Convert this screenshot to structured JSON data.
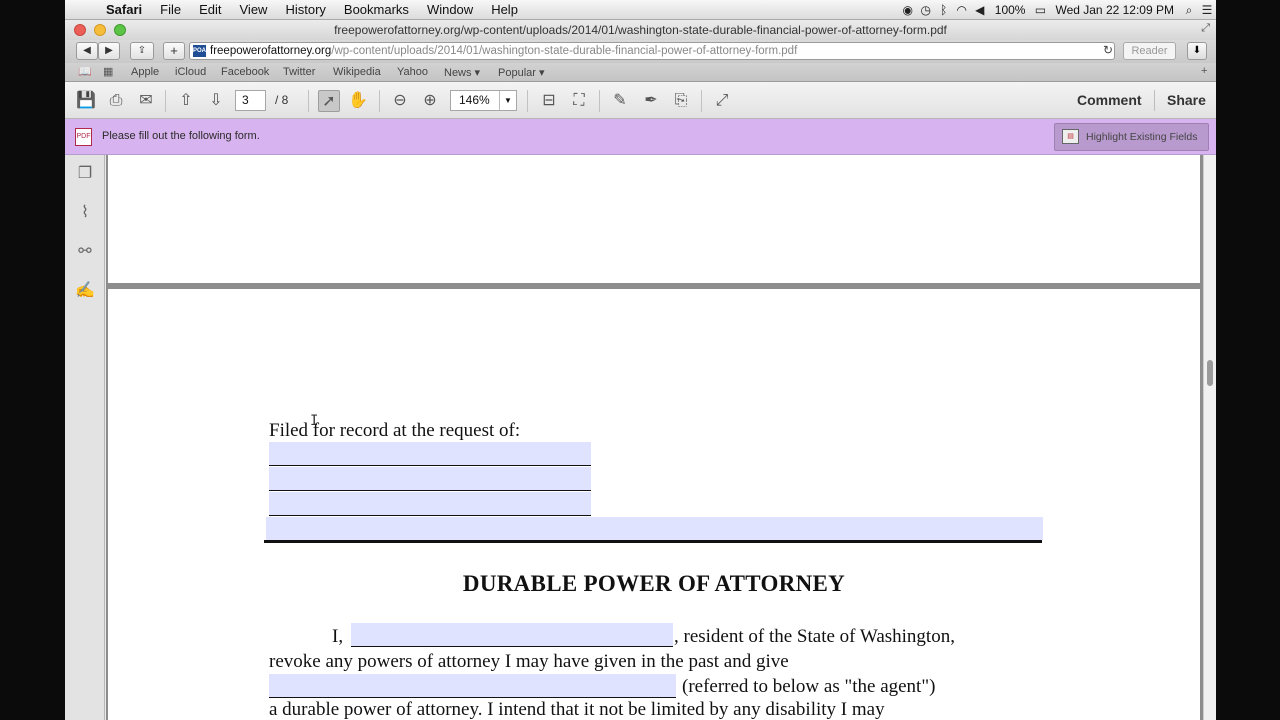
{
  "menubar": {
    "app": "Safari",
    "items": [
      "File",
      "Edit",
      "View",
      "History",
      "Bookmarks",
      "Window",
      "Help"
    ],
    "battery": "100%",
    "clock": "Wed Jan 22  12:09 PM"
  },
  "window": {
    "title": "freepowerofattorney.org/wp-content/uploads/2014/01/washington-state-durable-financial-power-of-attorney-form.pdf"
  },
  "toolbar": {
    "url_host": "freepowerofattorney.org",
    "url_path": "/wp-content/uploads/2014/01/washington-state-durable-financial-power-of-attorney-form.pdf",
    "favicon_text": "POA",
    "reader": "Reader"
  },
  "bookmarks": [
    "Apple",
    "iCloud",
    "Facebook",
    "Twitter",
    "Wikipedia",
    "Yahoo",
    "News ▾",
    "Popular ▾"
  ],
  "acrobat": {
    "page_current": "3",
    "page_total": "/ 8",
    "zoom": "146%",
    "comment": "Comment",
    "share": "Share"
  },
  "formbar": {
    "message": "Please fill out the following form.",
    "highlight_button": "Highlight Existing Fields"
  },
  "document": {
    "filed_for_record": "Filed for record at the request of:",
    "heading": "DURABLE POWER OF ATTORNEY",
    "line1_prefix": "I,",
    "line1_suffix": ", resident of the State of Washington,",
    "line2": "revoke any powers of attorney I may have given in the past and give",
    "line3_suffix": "(referred to below as \"the agent\")",
    "line4": "a durable power of attorney. I intend that it not be limited by any disability I may"
  },
  "scroll": {
    "position_fraction": 0.38
  }
}
